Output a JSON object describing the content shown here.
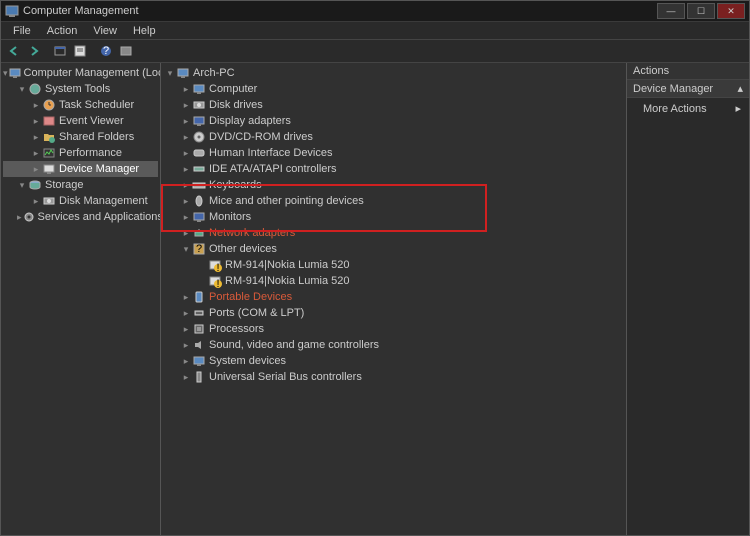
{
  "title": "Computer Management",
  "menus": [
    "File",
    "Action",
    "View",
    "Help"
  ],
  "left_tree": {
    "root": "Computer Management (Local)",
    "nodes": [
      {
        "label": "System Tools",
        "children": [
          {
            "label": "Task Scheduler"
          },
          {
            "label": "Event Viewer"
          },
          {
            "label": "Shared Folders"
          },
          {
            "label": "Performance"
          },
          {
            "label": "Device Manager",
            "selected": true
          }
        ]
      },
      {
        "label": "Storage",
        "children": [
          {
            "label": "Disk Management"
          }
        ]
      },
      {
        "label": "Services and Applications"
      }
    ]
  },
  "device_tree": {
    "root": "Arch-PC",
    "categories": [
      {
        "label": "Computer"
      },
      {
        "label": "Disk drives"
      },
      {
        "label": "Display adapters"
      },
      {
        "label": "DVD/CD-ROM drives"
      },
      {
        "label": "Human Interface Devices"
      },
      {
        "label": "IDE ATA/ATAPI controllers"
      },
      {
        "label": "Keyboards"
      },
      {
        "label": "Mice and other pointing devices"
      },
      {
        "label": "Monitors"
      },
      {
        "label": "Network adapters",
        "class": "netadapt"
      },
      {
        "label": "Other devices",
        "expanded": true,
        "children": [
          {
            "label": "RM-914|Nokia Lumia 520",
            "warning": true
          },
          {
            "label": "RM-914|Nokia Lumia 520",
            "warning": true
          }
        ]
      },
      {
        "label": "Portable Devices",
        "class": "netadapt"
      },
      {
        "label": "Ports (COM & LPT)"
      },
      {
        "label": "Processors"
      },
      {
        "label": "Sound, video and game controllers"
      },
      {
        "label": "System devices"
      },
      {
        "label": "Universal Serial Bus controllers"
      }
    ]
  },
  "actions": {
    "header": "Actions",
    "sub": "Device Manager",
    "item": "More Actions"
  }
}
